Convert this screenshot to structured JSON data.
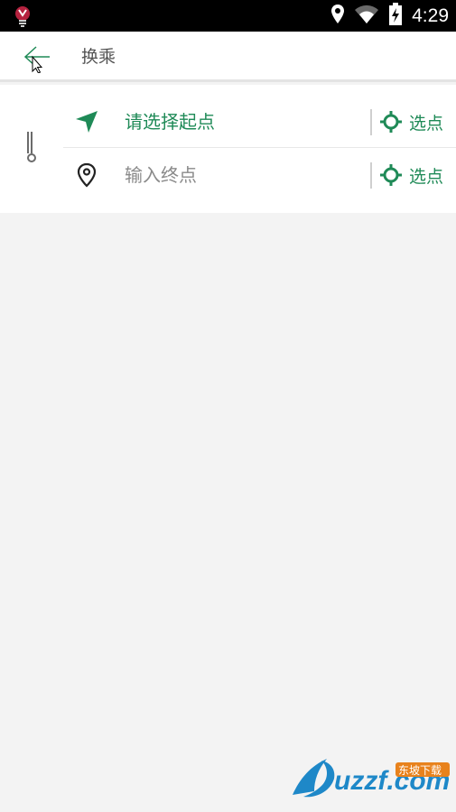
{
  "status_bar": {
    "time": "4:29",
    "icons": [
      "bulb-icon",
      "location-icon",
      "wifi-icon",
      "battery-charging-icon"
    ]
  },
  "app_bar": {
    "title": "换乘",
    "back_icon": "back-arrow-icon"
  },
  "route": {
    "start": {
      "text": "请选择起点",
      "icon": "navigation-arrow-icon",
      "pick_label": "选点"
    },
    "end": {
      "text": "输入终点",
      "icon": "location-pin-icon",
      "pick_label": "选点"
    },
    "swap_icon": "swap-route-icon"
  },
  "watermark": {
    "brand": "uzzf.com",
    "subtitle": "东坡下载"
  },
  "colors": {
    "accent": "#1f8a57",
    "status_bar": "#000000",
    "background": "#f3f3f3"
  }
}
